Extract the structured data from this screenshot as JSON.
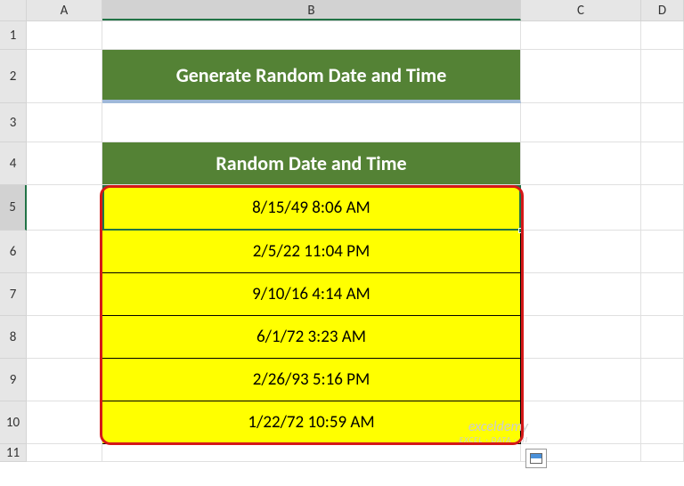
{
  "columns": {
    "A": "A",
    "B": "B",
    "C": "C",
    "D": "D"
  },
  "rows": {
    "r1": "1",
    "r2": "2",
    "r3": "3",
    "r4": "4",
    "r5": "5",
    "r6": "6",
    "r7": "7",
    "r8": "8",
    "r9": "9",
    "r10": "10",
    "r11": "11"
  },
  "title": "Generate Random Date and Time",
  "column_header": "Random Date and Time",
  "data": {
    "d1": "8/15/49 8:06 AM",
    "d2": "2/5/22 11:04 PM",
    "d3": "9/10/16 4:14 AM",
    "d4": "6/1/72 3:23 AM",
    "d5": "2/26/93 5:16 PM",
    "d6": "1/22/72 10:59 AM"
  },
  "watermark": {
    "main": "exceldemy",
    "sub": "EXCEL · DATA · BI"
  },
  "chart_data": {
    "type": "table",
    "title": "Generate Random Date and Time",
    "columns": [
      "Random Date and Time"
    ],
    "rows": [
      [
        "8/15/49 8:06 AM"
      ],
      [
        "2/5/22 11:04 PM"
      ],
      [
        "9/10/16 4:14 AM"
      ],
      [
        "6/1/72 3:23 AM"
      ],
      [
        "2/26/93 5:16 PM"
      ],
      [
        "1/22/72 10:59 AM"
      ]
    ]
  }
}
